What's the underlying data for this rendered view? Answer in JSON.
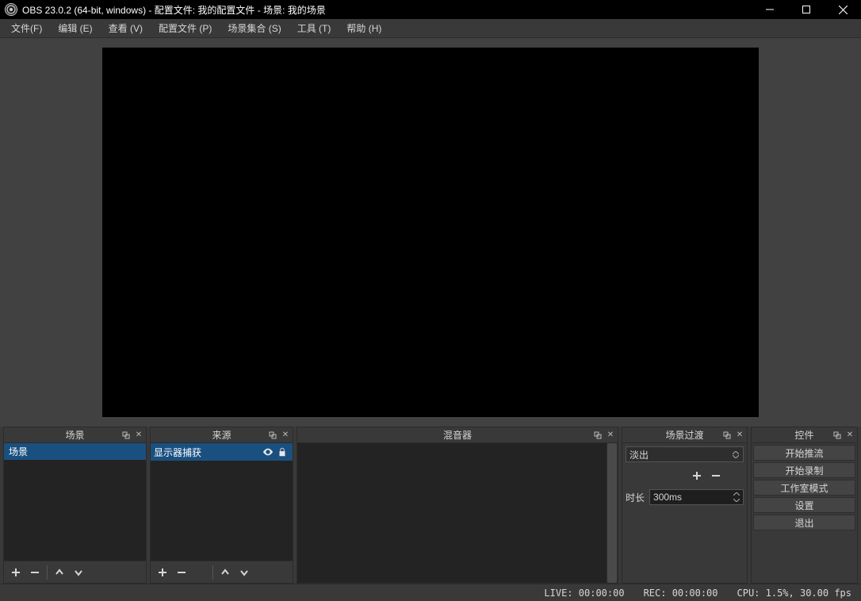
{
  "titlebar": {
    "text": "OBS 23.0.2 (64-bit, windows) - 配置文件: 我的配置文件 - 场景: 我的场景"
  },
  "menubar": {
    "items": [
      {
        "label": "文件(F)"
      },
      {
        "label": "编辑 (E)"
      },
      {
        "label": "查看 (V)"
      },
      {
        "label": "配置文件 (P)"
      },
      {
        "label": "场景集合 (S)"
      },
      {
        "label": "工具 (T)"
      },
      {
        "label": "帮助 (H)"
      }
    ]
  },
  "docks": {
    "scenes": {
      "title": "场景",
      "items": [
        {
          "name": "场景"
        }
      ]
    },
    "sources": {
      "title": "来源",
      "items": [
        {
          "name": "显示器捕获"
        }
      ]
    },
    "mixer": {
      "title": "混音器"
    },
    "transitions": {
      "title": "场景过渡",
      "selected": "淡出",
      "duration_label": "时长",
      "duration_value": "300ms"
    },
    "controls": {
      "title": "控件",
      "buttons": [
        {
          "label": "开始推流"
        },
        {
          "label": "开始录制"
        },
        {
          "label": "工作室模式"
        },
        {
          "label": "设置"
        },
        {
          "label": "退出"
        }
      ]
    }
  },
  "statusbar": {
    "live": "LIVE: 00:00:00",
    "rec": "REC: 00:00:00",
    "cpu": "CPU: 1.5%, 30.00 fps"
  }
}
